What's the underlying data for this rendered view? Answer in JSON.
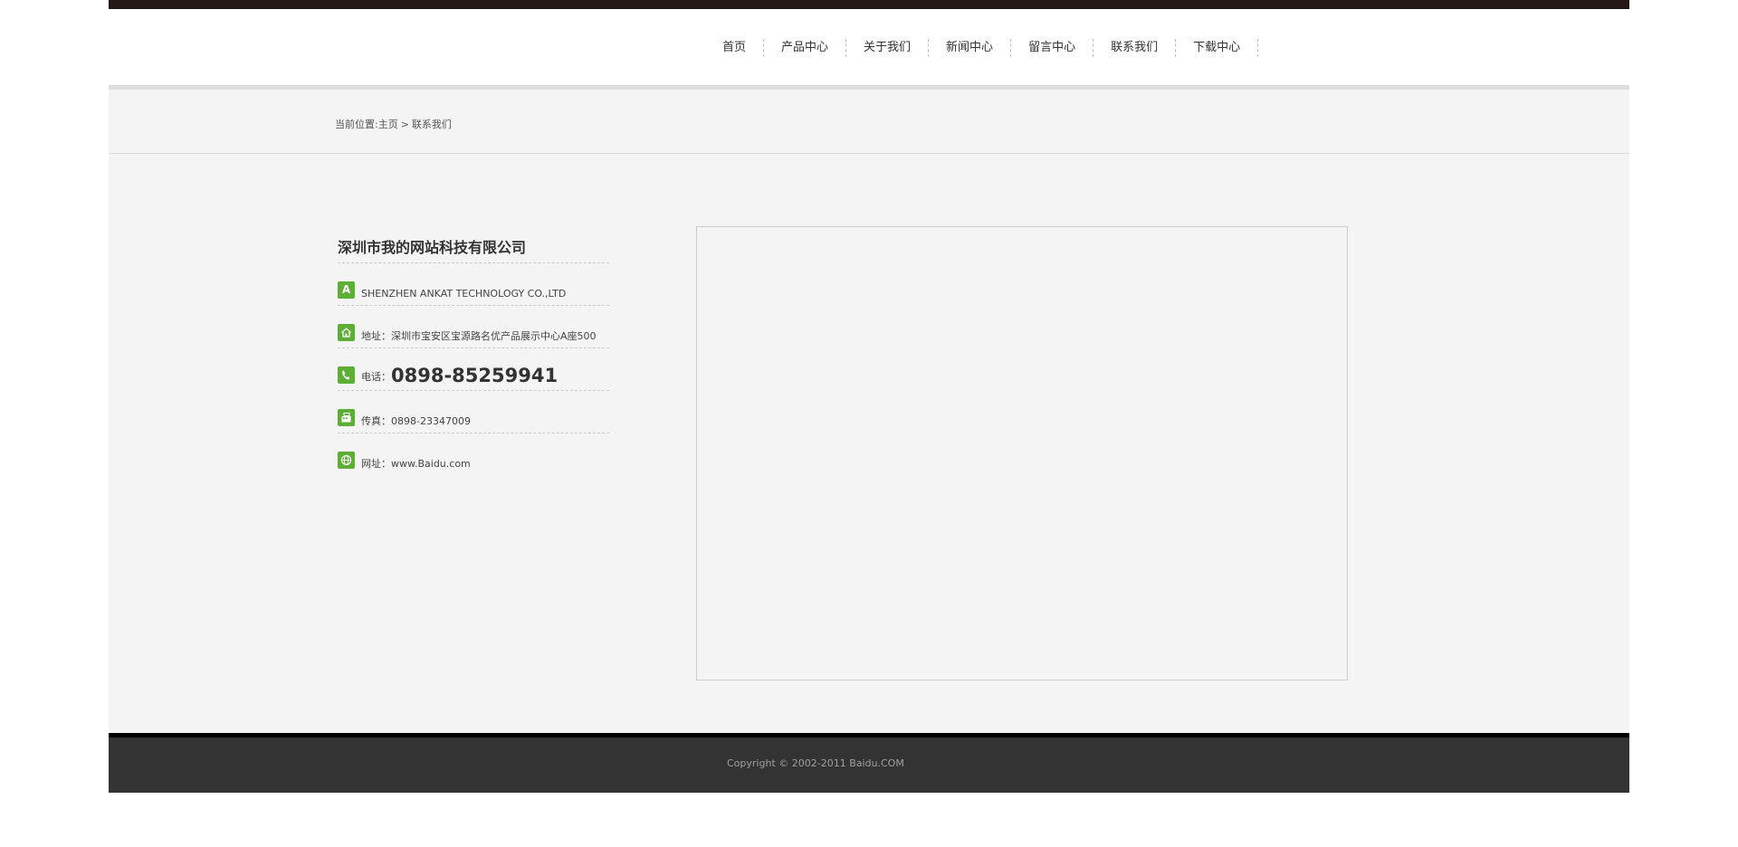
{
  "nav": {
    "items": [
      "首页",
      "产品中心",
      "关于我们",
      "新闻中心",
      "留言中心",
      "联系我们",
      "下载中心"
    ]
  },
  "breadcrumb": {
    "prefix": "当前位置:",
    "home": "主页",
    "separator": ">",
    "current": "联系我们"
  },
  "contact": {
    "company_name": "深圳市我的网站科技有限公司",
    "company_name_en": "SHENZHEN ANKAT TECHNOLOGY CO.,LTD",
    "en_icon_letter": "A",
    "address_label": "地址：",
    "address_value": "深圳市宝安区宝源路名优产品展示中心A座500",
    "phone_label": "电话：",
    "phone_value": "0898-85259941",
    "fax_label": "传真：",
    "fax_value": "0898-23347009",
    "website_label": "网址：",
    "website_value": "www.Baidu.com",
    "icons": [
      "letter-a-icon",
      "home-icon",
      "phone-icon",
      "fax-icon",
      "globe-icon"
    ],
    "icon_color": "#5dae35"
  },
  "footer": {
    "copyright": "Copyright © 2002-2011 Baidu.COM"
  },
  "colors": {
    "top_bar": "#231815",
    "content_bg": "#f4f4f4",
    "footer_bg": "#333333",
    "accent": "#5dae35"
  }
}
